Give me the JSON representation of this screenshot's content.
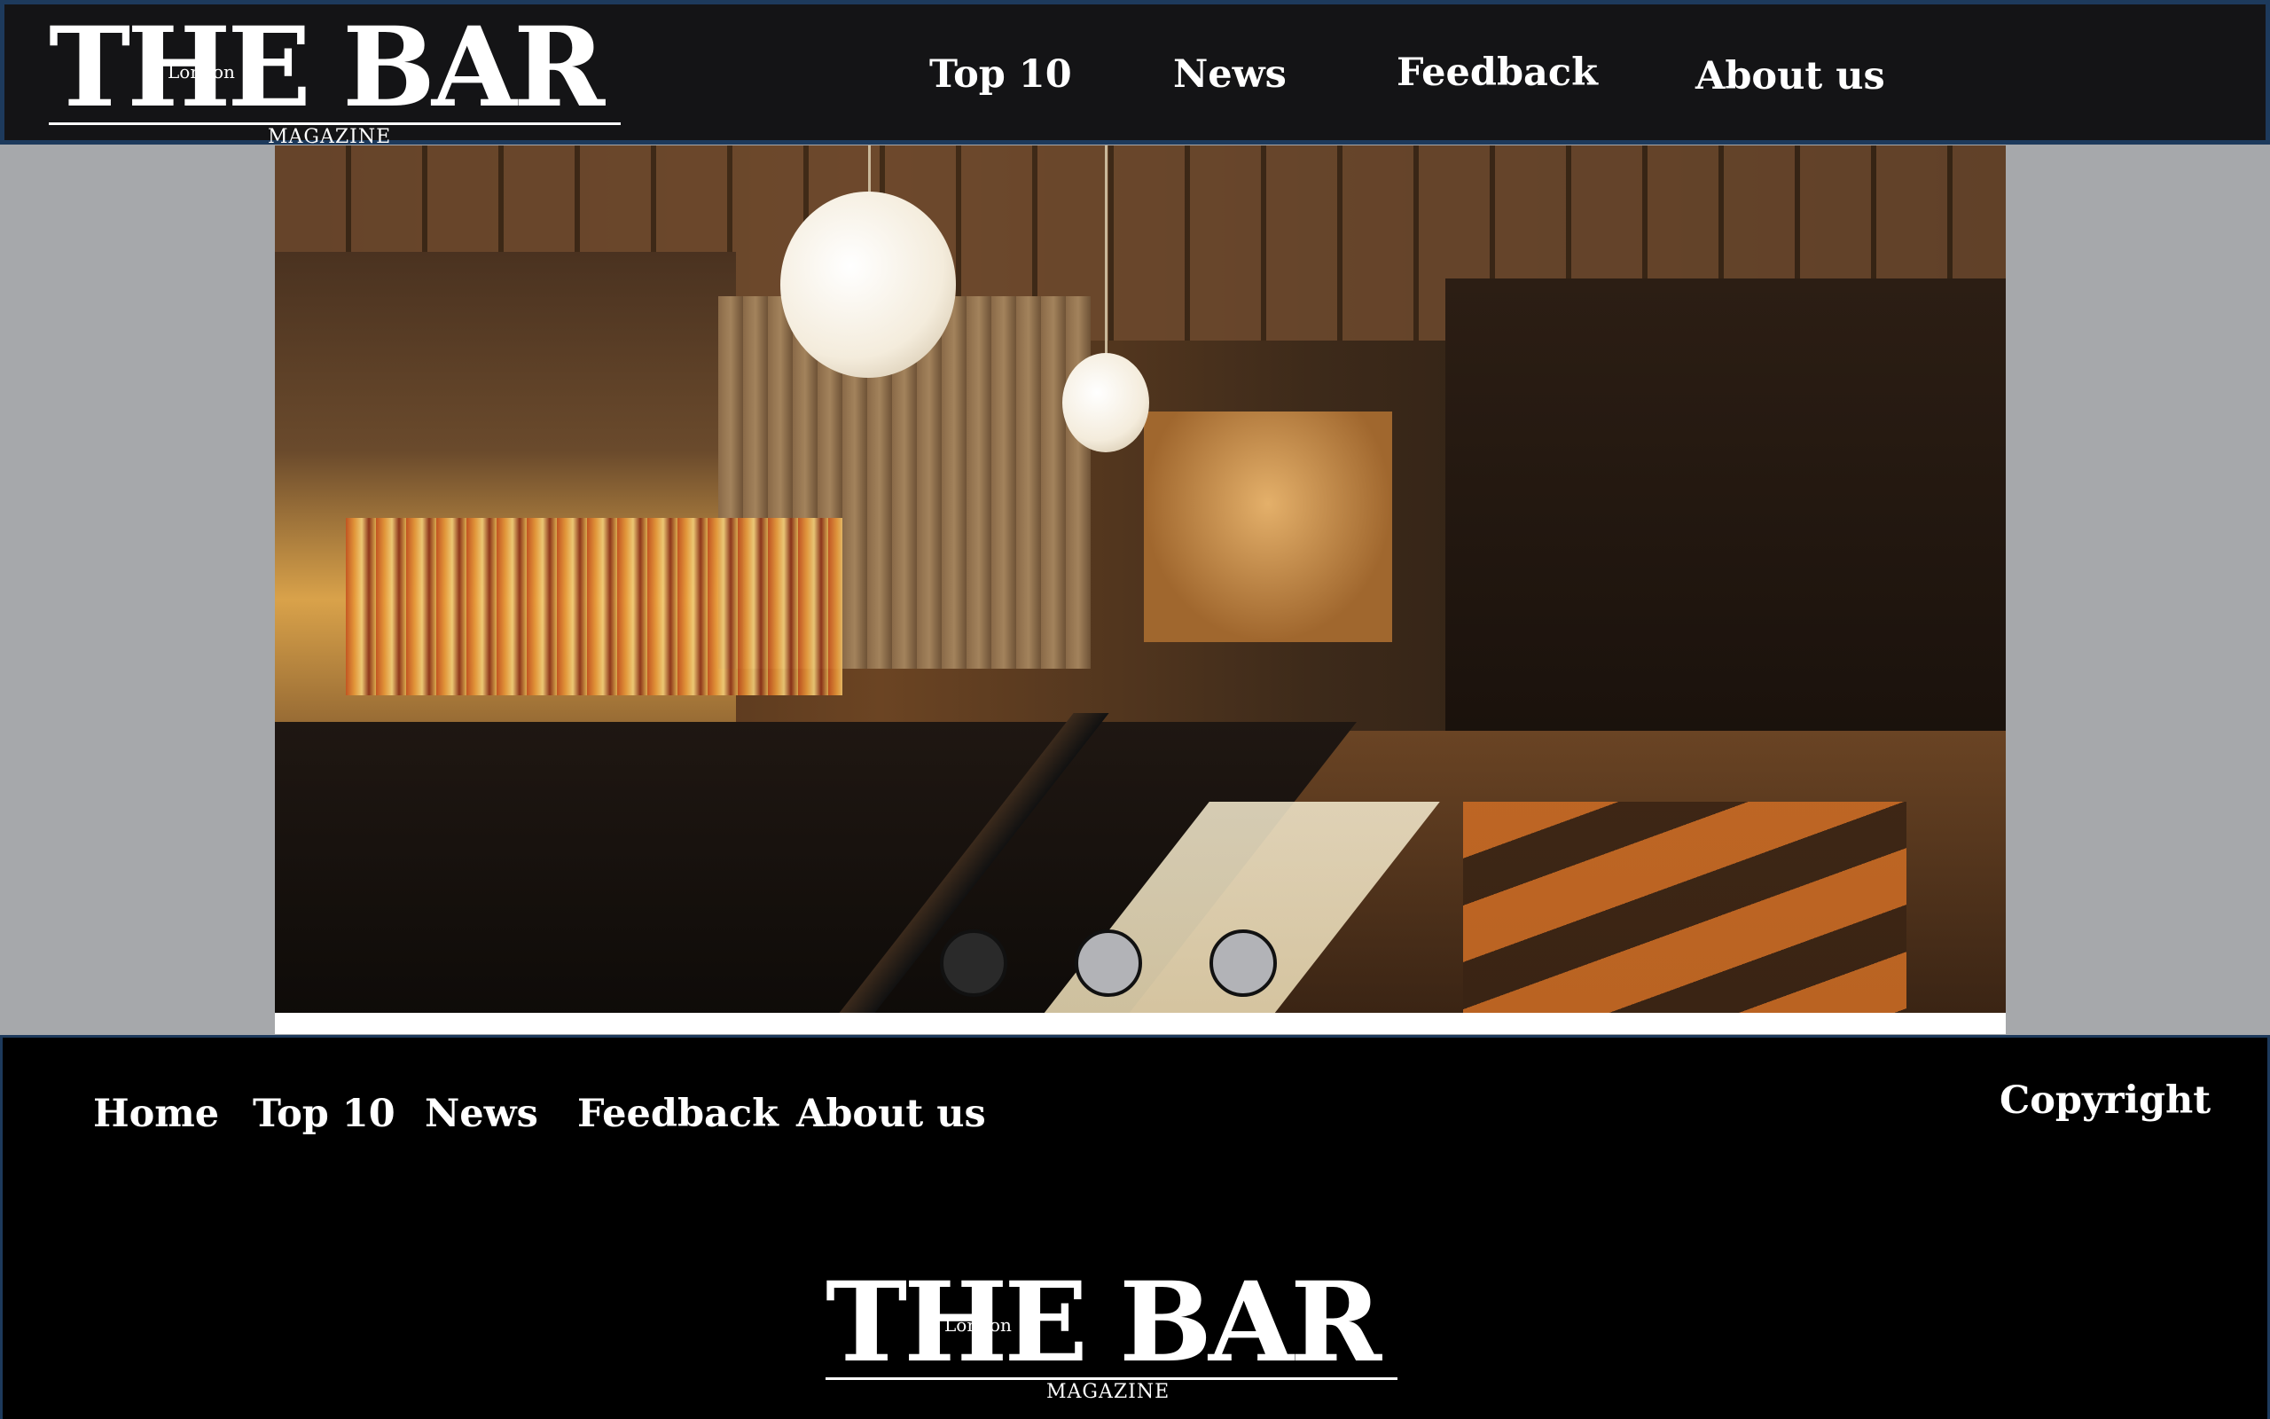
{
  "brand": {
    "wordmark": "THE BAR",
    "city": "London",
    "subtitle": "MAGAZINE"
  },
  "header": {
    "nav": [
      "Top 10",
      "News",
      "Feedback",
      "About us"
    ]
  },
  "hero": {
    "image": "bar-interior-photo",
    "slides_total": 3,
    "active_slide": 1
  },
  "footer": {
    "nav": [
      "Home",
      "Top 10",
      "News",
      "Feedback",
      "About us"
    ],
    "copyright": "Copyright"
  },
  "colors": {
    "header_bg": "#141416",
    "footer_bg": "#000000",
    "page_bg": "#a6a8ab",
    "border": "#1d3a5c",
    "dot_active": "#2a2a2a",
    "dot_inactive": "#b2b3b7"
  }
}
